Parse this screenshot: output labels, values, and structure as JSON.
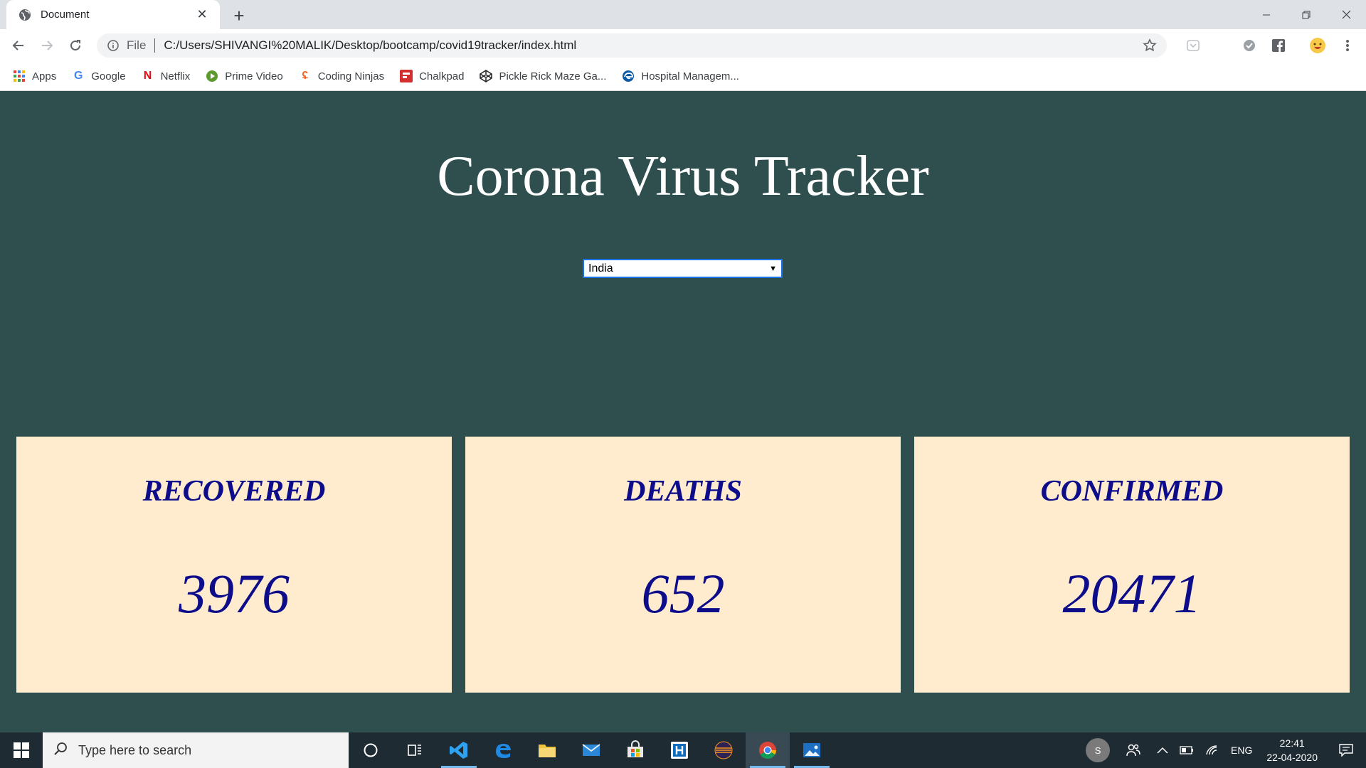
{
  "browser": {
    "tab_title": "Document",
    "url_scheme": "File",
    "url": "C:/Users/SHIVANGI%20MALIK/Desktop/bootcamp/covid19tracker/index.html",
    "bookmarks": [
      {
        "label": "Apps",
        "icon": "apps-grid-icon"
      },
      {
        "label": "Google",
        "icon": "google-icon"
      },
      {
        "label": "Netflix",
        "icon": "netflix-icon"
      },
      {
        "label": "Prime Video",
        "icon": "prime-video-icon"
      },
      {
        "label": "Coding Ninjas",
        "icon": "coding-ninjas-icon"
      },
      {
        "label": "Chalkpad",
        "icon": "chalkpad-icon"
      },
      {
        "label": "Pickle Rick Maze Ga...",
        "icon": "codepen-icon"
      },
      {
        "label": "Hospital Managem...",
        "icon": "edge-icon"
      }
    ]
  },
  "page": {
    "title": "Corona Virus Tracker",
    "country_select": {
      "selected": "India"
    },
    "stats": [
      {
        "label": "RECOVERED",
        "value": "3976"
      },
      {
        "label": "DEATHS",
        "value": "652"
      },
      {
        "label": "CONFIRMED",
        "value": "20471"
      }
    ],
    "colors": {
      "background": "#2f4f4f",
      "card": "#ffebcd",
      "card_text": "#0d0d8c"
    }
  },
  "taskbar": {
    "search_placeholder": "Type here to search",
    "avatar_initial": "S",
    "language": "ENG",
    "time": "22:41",
    "date": "22-04-2020"
  }
}
